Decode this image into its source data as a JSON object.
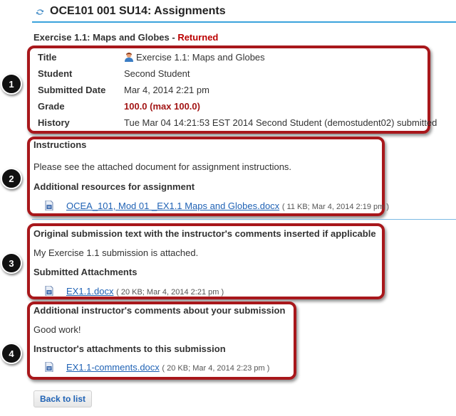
{
  "page": {
    "site_title": "OCE101 001 SU14: Assignments",
    "assignment_title": "Exercise 1.1: Maps and Globes",
    "title_separator": " - ",
    "assignment_status": "Returned"
  },
  "details": {
    "rows": [
      {
        "label": "Title",
        "value": "Exercise 1.1: Maps and Globes"
      },
      {
        "label": "Student",
        "value": "Second Student"
      },
      {
        "label": "Submitted Date",
        "value": "Mar 4, 2014 2:21 pm"
      },
      {
        "label": "Grade",
        "value": "100.0 (max 100.0)"
      },
      {
        "label": "History",
        "value": "Tue Mar 04 14:21:53 EST 2014 Second Student (demostudent02) submitted"
      }
    ]
  },
  "instructions": {
    "heading": "Instructions",
    "text": "Please see the attached document for assignment instructions.",
    "resources_heading": "Additional resources for assignment",
    "attachment": {
      "name": "OCEA_101, Mod 01 _EX1.1 Maps and Globes.docx",
      "meta": "( 11 KB; Mar 4, 2014 2:19 pm )"
    }
  },
  "submission": {
    "heading": "Original submission text with the instructor's comments inserted if applicable",
    "text": "My Exercise 1.1 submission is attached.",
    "attachments_heading": "Submitted Attachments",
    "attachment": {
      "name": "EX1.1.docx",
      "meta": "( 20 KB; Mar 4, 2014 2:21 pm )"
    }
  },
  "feedback": {
    "heading": "Additional instructor's comments about your submission",
    "text": "Good work!",
    "attachments_heading": "Instructor's attachments to this submission",
    "attachment": {
      "name": "EX1.1-comments.docx",
      "meta": "( 20 KB; Mar 4, 2014 2:23 pm )"
    }
  },
  "callouts": [
    "1",
    "2",
    "3",
    "4"
  ],
  "buttons": {
    "back": "Back to list"
  },
  "icons": {
    "reset": "reset-arrows-icon",
    "student": "student-avatar-icon",
    "doc": "word-document-icon"
  },
  "colors": {
    "highlight": "#a8171b",
    "status": "#b00000",
    "link": "#1f62b5",
    "rule": "#3aa3dc"
  }
}
